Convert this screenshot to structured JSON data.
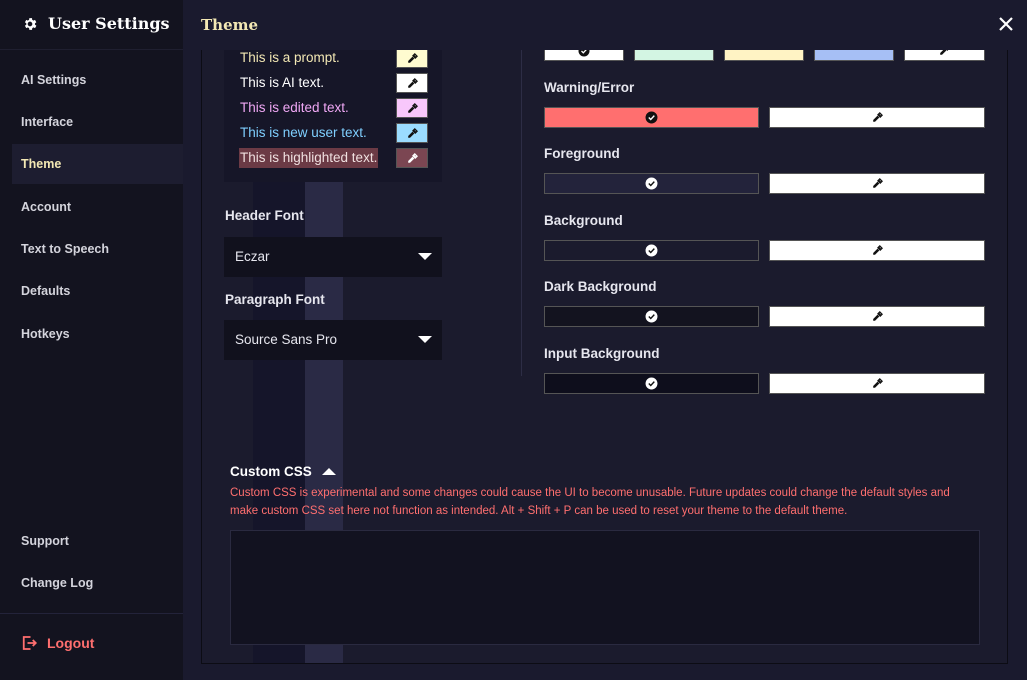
{
  "sidebar": {
    "title": "User Settings",
    "items": [
      {
        "label": "AI Settings",
        "active": false
      },
      {
        "label": "Interface",
        "active": false
      },
      {
        "label": "Theme",
        "active": true
      },
      {
        "label": "Account",
        "active": false
      },
      {
        "label": "Text to Speech",
        "active": false
      },
      {
        "label": "Defaults",
        "active": false
      },
      {
        "label": "Hotkeys",
        "active": false
      }
    ],
    "bottom_items": [
      {
        "label": "Support"
      },
      {
        "label": "Change Log"
      }
    ],
    "logout_label": "Logout"
  },
  "header": {
    "title": "Theme"
  },
  "text_samples": [
    {
      "text": "This is a prompt.",
      "color": "#f3e8b4",
      "swatch": "#fffbd0"
    },
    {
      "text": "This is AI text.",
      "color": "#ffffff",
      "swatch": "#ffffff"
    },
    {
      "text": "This is edited text.",
      "color": "#f0a8f5",
      "swatch": "#f8c7fb"
    },
    {
      "text": "This is new user text.",
      "color": "#7fcfff",
      "swatch": "#9bdcff"
    },
    {
      "text": "This is highlighted text.",
      "color": "#f0e0e0",
      "bg": "#6b3a45",
      "swatch": "#7b4652"
    }
  ],
  "fonts": {
    "header_label": "Header Font",
    "header_value": "Eczar",
    "paragraph_label": "Paragraph Font",
    "paragraph_value": "Source Sans Pro"
  },
  "color_rows": [
    {
      "label": "Warning/Error",
      "color": "#ff6f6f"
    },
    {
      "label": "Foreground",
      "color": "#23233b"
    },
    {
      "label": "Background",
      "color": "#1b1b2d"
    },
    {
      "label": "Dark Background",
      "color": "#13131f"
    },
    {
      "label": "Input Background",
      "color": "#0e0e1c"
    }
  ],
  "top_partial_swatches": [
    "#ffffff",
    "#d3f5e3",
    "#fff3c4",
    "#a6bff5",
    "#ffffff"
  ],
  "custom_css": {
    "label": "Custom CSS",
    "warning": "Custom CSS is experimental and some changes could cause the UI to become unusable. Future updates could change the default styles and make custom CSS set here not function as intended. Alt + Shift + P can be used to reset your theme to the default theme.",
    "value": ""
  },
  "colors": {
    "accent": "#f3e8b4",
    "danger": "#ff6f6f"
  }
}
